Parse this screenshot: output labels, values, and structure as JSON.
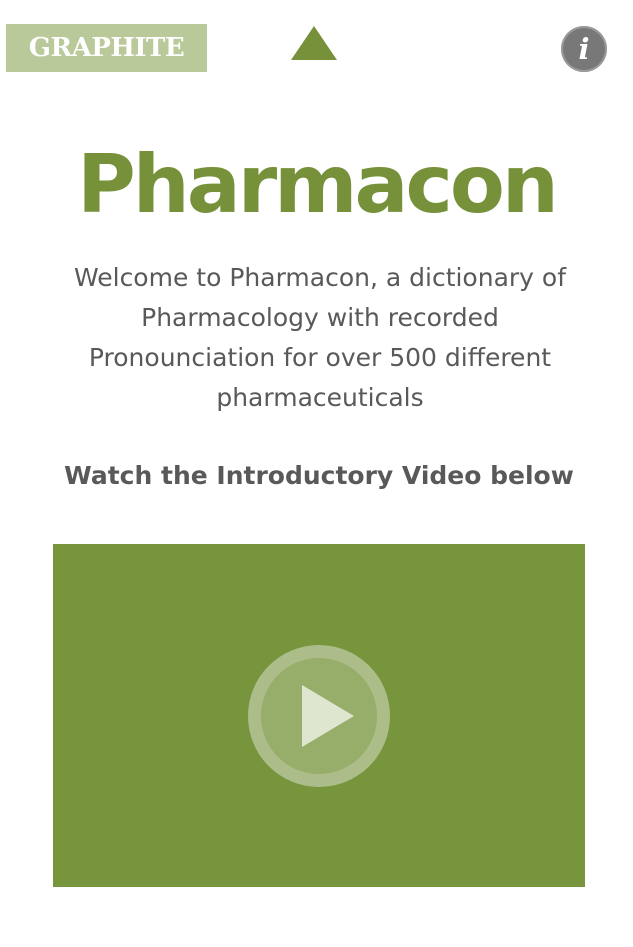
{
  "header": {
    "brand_label": "GRAPHITE",
    "up_icon": "triangle-up-icon",
    "info_icon": "info-icon",
    "info_glyph": "i"
  },
  "main": {
    "title": "Pharmacon",
    "welcome": "Welcome to Pharmacon, a dictionary of Pharmacology with recorded Pronounciation for over 500 different pharmaceuticals",
    "video_caption": "Watch the Introductory Video below",
    "play_icon": "play-icon"
  },
  "colors": {
    "accent_green": "#76913a",
    "video_bg": "#77953c",
    "brand_bg": "#b9c99a",
    "text_gray": "#595959",
    "info_gray": "#787878"
  }
}
